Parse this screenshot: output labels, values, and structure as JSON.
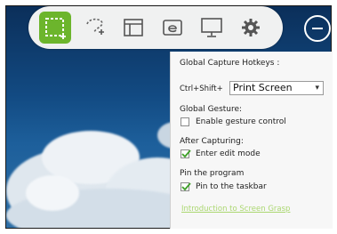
{
  "toolbar": {
    "buttons": [
      {
        "name": "rectangle-capture",
        "icon": "rectangle-select-icon",
        "active": true
      },
      {
        "name": "freeform-capture",
        "icon": "lasso-select-icon",
        "active": false
      },
      {
        "name": "window-capture",
        "icon": "window-icon",
        "active": false
      },
      {
        "name": "browser-capture",
        "icon": "browser-e-icon",
        "active": false
      },
      {
        "name": "fullscreen-capture",
        "icon": "monitor-icon",
        "active": false
      },
      {
        "name": "settings",
        "icon": "gear-icon",
        "active": false
      }
    ],
    "accent_color": "#6cb52c"
  },
  "settings_panel": {
    "hotkeys_title": "Global Capture Hotkeys :",
    "hotkey_prefix": "Ctrl+Shift+",
    "hotkey_value": "Print Screen",
    "gesture_title": "Global Gesture:",
    "gesture_label": "Enable gesture control",
    "gesture_checked": false,
    "after_title": "After Capturing:",
    "after_label": "Enter edit mode",
    "after_checked": true,
    "pin_title": "Pin the program",
    "pin_label": "Pin to the taskbar",
    "pin_checked": true,
    "link_text": "Introduction to Screen Grasp"
  }
}
